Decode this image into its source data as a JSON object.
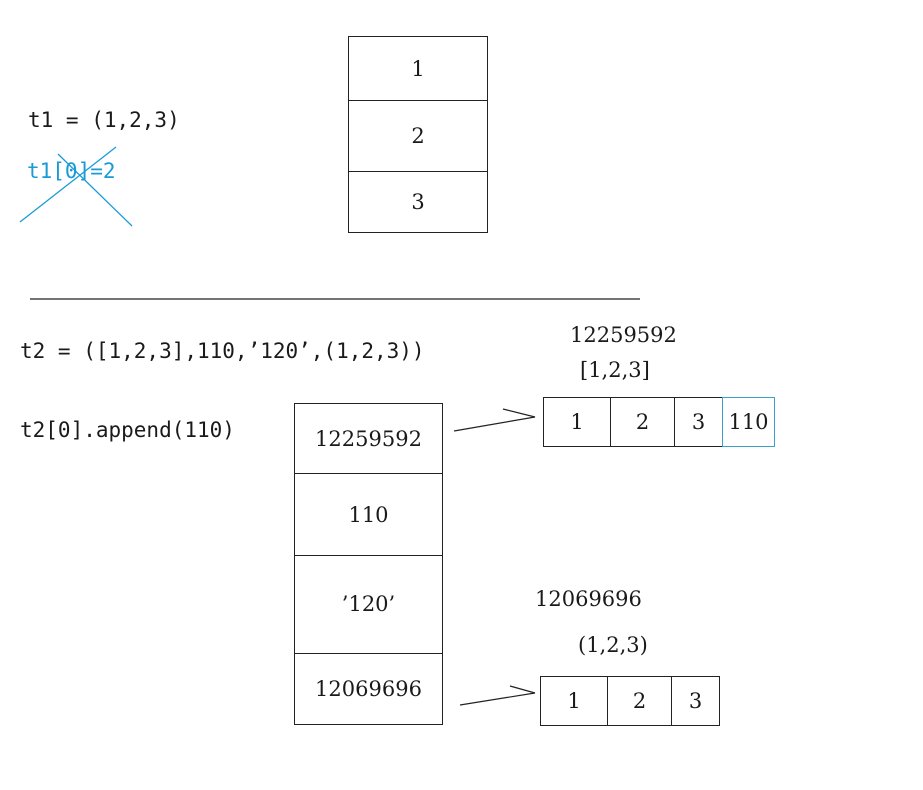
{
  "top": {
    "code_t1": "t1 = (1,2,3)",
    "code_t1_assign": "t1[0]=2",
    "memory_stack": [
      "1",
      "2",
      "3"
    ]
  },
  "bottom": {
    "code_t2": "t2 = ([1,2,3],110,’120’,(1,2,3))",
    "code_append": "t2[0].append(110)",
    "memory_stack": [
      "12259592",
      "110",
      "’120’",
      "12069696"
    ],
    "list_object": {
      "address": "12259592",
      "label": "[1,2,3]",
      "cells": [
        "1",
        "2",
        "3",
        "110"
      ]
    },
    "tuple_object": {
      "address": "12069696",
      "label": "(1,2,3)",
      "cells": [
        "1",
        "2",
        "3"
      ]
    }
  },
  "colors": {
    "stroke": "#222222",
    "strike": "#1a9bd7",
    "appended_cell": "#3aa0c8"
  }
}
